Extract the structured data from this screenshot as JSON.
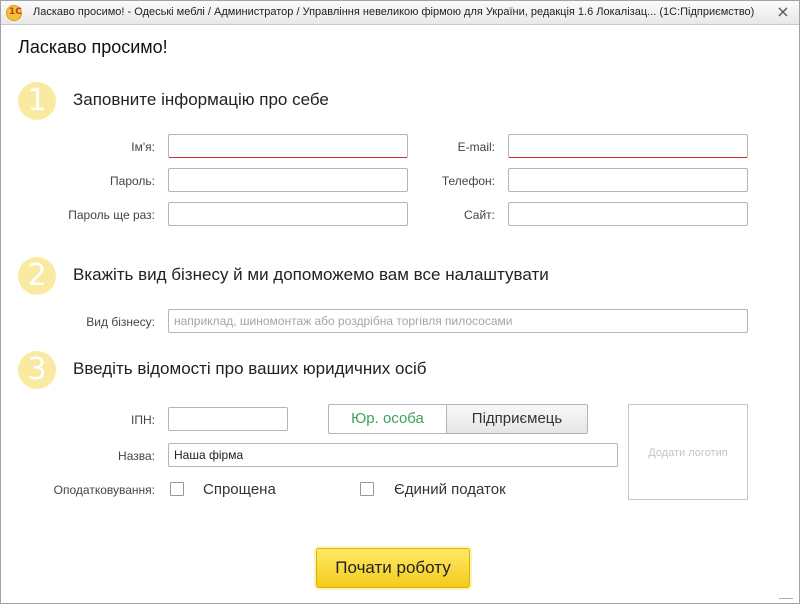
{
  "window": {
    "title": "Ласкаво просимо! - Одеські меблі / Администратор / Управління невеликою фірмою для України, редакція 1.6 Локалізац...  (1С:Підприємство)",
    "app_icon_text": "1C",
    "close_glyph": "×"
  },
  "page": {
    "heading": "Ласкаво просимо!"
  },
  "step1": {
    "number": "1",
    "title": "Заповните інформацію про себе",
    "name_label": "Ім'я:",
    "name_value": "",
    "password_label": "Пароль:",
    "password_value": "",
    "password_repeat_label": "Пароль ще раз:",
    "password_repeat_value": "",
    "email_label": "E-mail:",
    "email_value": "",
    "phone_label": "Телефон:",
    "phone_value": "",
    "site_label": "Сайт:",
    "site_value": ""
  },
  "step2": {
    "number": "2",
    "title": "Вкажіть вид бізнесу й ми допоможемо вам все налаштувати",
    "business_label": "Вид бізнесу:",
    "business_placeholder": "наприклад, шиномонтаж або роздрібна торгівля пилососами",
    "business_value": ""
  },
  "step3": {
    "number": "3",
    "title": "Введіть відомості про ваших юридичних осіб",
    "ipn_label": "ІПН:",
    "ipn_value": "",
    "entity_type_options": [
      "Юр. особа",
      "Підприємець"
    ],
    "entity_type_selected": "Юр. особа",
    "name_label": "Назва:",
    "name_value": "Наша фірма",
    "taxation_label": "Оподатковування:",
    "taxation_options": [
      {
        "label": "Спрощена",
        "checked": false
      },
      {
        "label": "Єдиний податок",
        "checked": false
      }
    ],
    "add_logo_label": "Додати логотип"
  },
  "footer": {
    "start_button_label": "Почати роботу"
  },
  "colors": {
    "accent_yellow": "#f3cb1c",
    "step_circle": "#fae9a0",
    "selected_segment_text": "#3ba35c",
    "required_underline": "#c9302c"
  }
}
